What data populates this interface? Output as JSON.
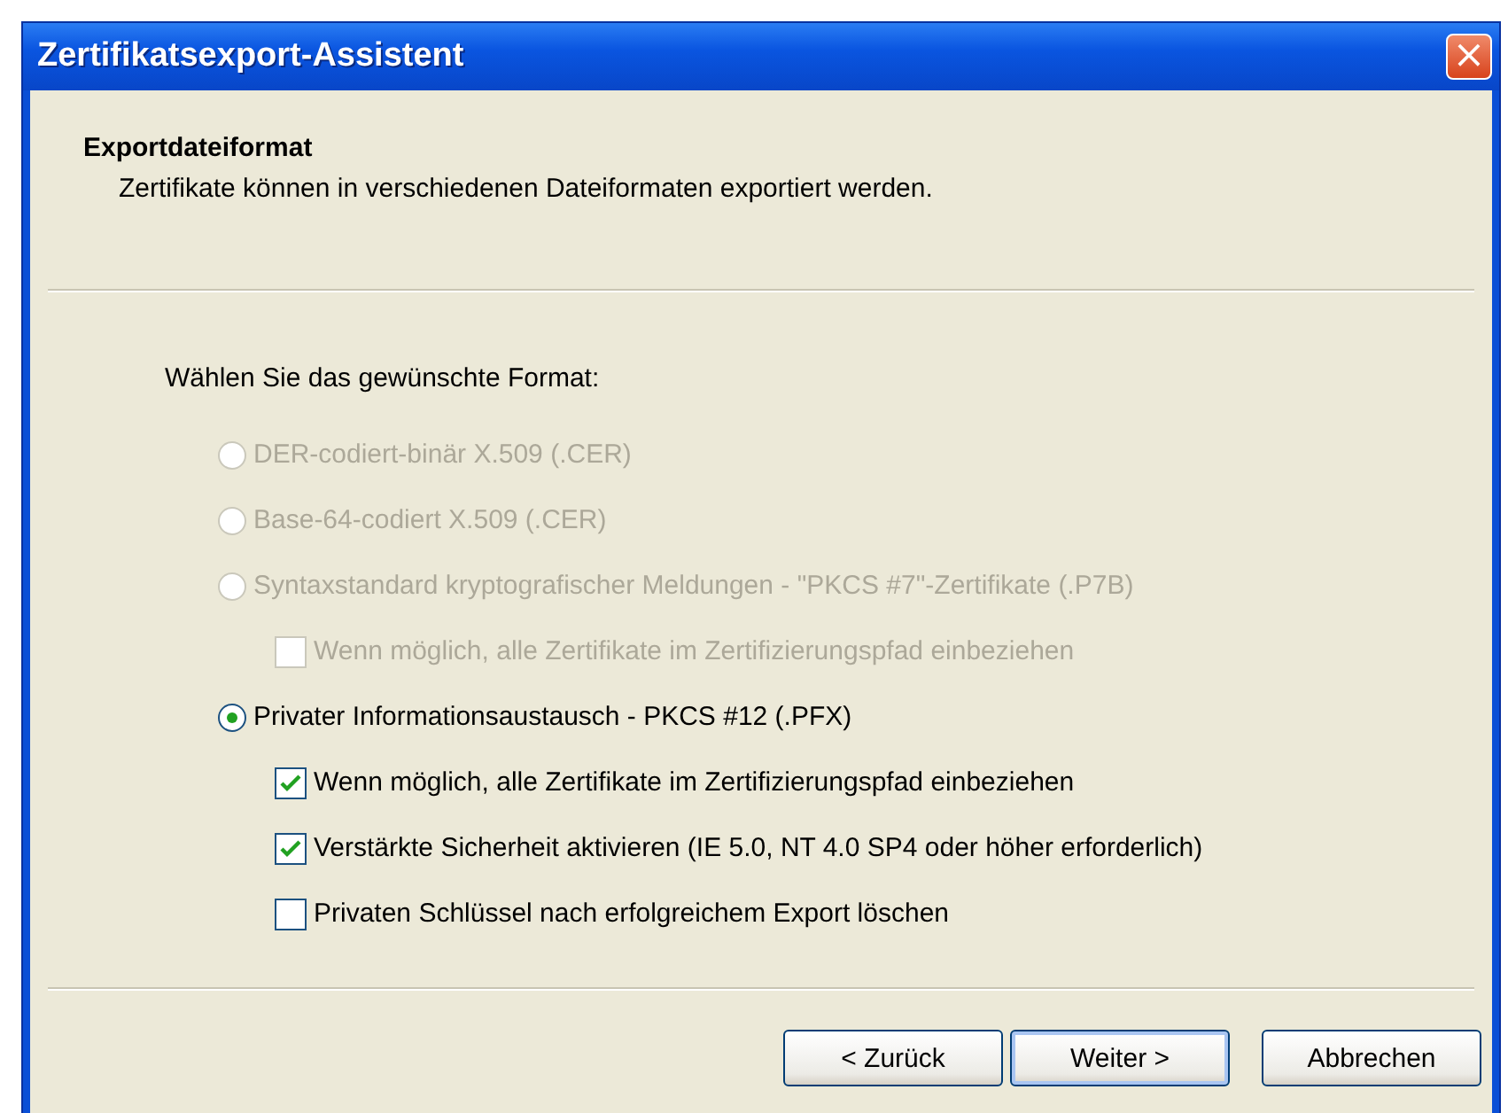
{
  "window": {
    "title": "Zertifikatsexport-Assistent",
    "close": "×"
  },
  "header": {
    "title": "Exportdateiformat",
    "subtitle": "Zertifikate können in verschiedenen Dateiformaten exportiert werden."
  },
  "prompt": "Wählen Sie das gewünschte Format:",
  "options": [
    {
      "kind": "radio",
      "label": "DER-codiert-binär X.509 (.CER)",
      "selected": false,
      "disabled": true
    },
    {
      "kind": "radio",
      "label": "Base-64-codiert X.509 (.CER)",
      "selected": false,
      "disabled": true
    },
    {
      "kind": "radio",
      "label": "Syntaxstandard kryptografischer Meldungen - \"PKCS #7\"-Zertifikate (.P7B)",
      "selected": false,
      "disabled": true,
      "children": [
        {
          "kind": "checkbox",
          "label": "Wenn möglich, alle Zertifikate im Zertifizierungspfad einbeziehen",
          "checked": false,
          "disabled": true
        }
      ]
    },
    {
      "kind": "radio",
      "label": "Privater Informationsaustausch - PKCS #12 (.PFX)",
      "selected": true,
      "disabled": false,
      "children": [
        {
          "kind": "checkbox",
          "label": "Wenn möglich, alle Zertifikate im Zertifizierungspfad einbeziehen",
          "checked": true,
          "disabled": false
        },
        {
          "kind": "checkbox",
          "label": "Verstärkte Sicherheit aktivieren (IE 5.0, NT 4.0 SP4 oder höher erforderlich)",
          "checked": true,
          "disabled": false
        },
        {
          "kind": "checkbox",
          "label": "Privaten Schlüssel nach erfolgreichem Export löschen",
          "checked": false,
          "disabled": false
        }
      ]
    }
  ],
  "buttons": [
    {
      "label": "< Zurück",
      "default": false
    },
    {
      "label": "Weiter >",
      "default": true
    },
    {
      "label": "Abbrechen",
      "default": false
    }
  ]
}
